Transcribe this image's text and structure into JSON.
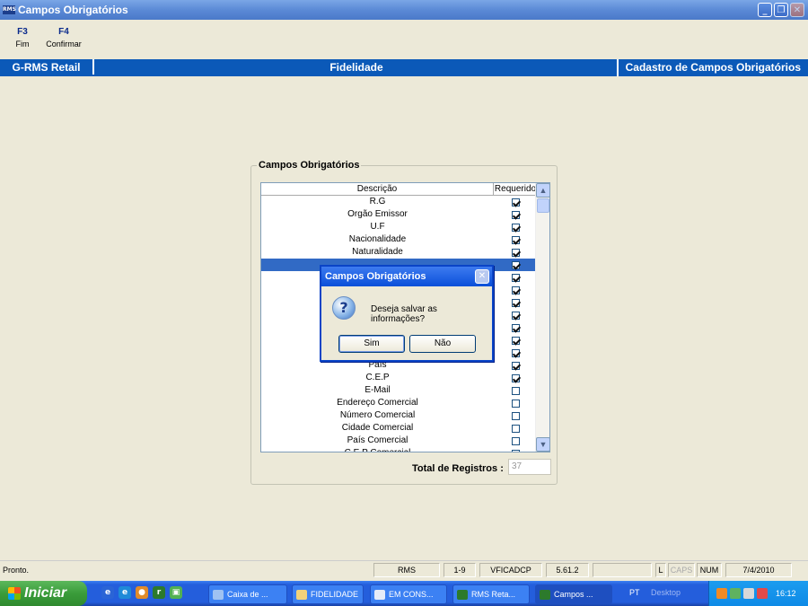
{
  "window": {
    "title": "Campos Obrigatórios",
    "app_icon_text": "RMS"
  },
  "toolbar": {
    "keys": [
      {
        "key": "F3",
        "label": "Fim"
      },
      {
        "key": "F4",
        "label": "Confirmar"
      }
    ]
  },
  "header": {
    "left": "G-RMS Retail",
    "center": "Fidelidade",
    "right": "Cadastro de Campos Obrigatórios"
  },
  "group": {
    "title": "Campos Obrigatórios",
    "columns": {
      "description": "Descrição",
      "required": "Requerido"
    },
    "rows": [
      {
        "desc": "R.G",
        "checked": true
      },
      {
        "desc": "Orgão Emissor",
        "checked": true
      },
      {
        "desc": "U.F",
        "checked": true
      },
      {
        "desc": "Nacionalidade",
        "checked": true
      },
      {
        "desc": "Naturalidade",
        "checked": true
      },
      {
        "desc": "",
        "checked": true,
        "selected": true
      },
      {
        "desc": "",
        "checked": true
      },
      {
        "desc": "",
        "checked": true
      },
      {
        "desc": "",
        "checked": true
      },
      {
        "desc": "",
        "checked": true
      },
      {
        "desc": "",
        "checked": true
      },
      {
        "desc": "",
        "checked": true
      },
      {
        "desc": "",
        "checked": true
      },
      {
        "desc": "País",
        "checked": true
      },
      {
        "desc": "C.E.P",
        "checked": true
      },
      {
        "desc": "E-Mail",
        "checked": false
      },
      {
        "desc": "Endereço Comercial",
        "checked": false
      },
      {
        "desc": "Número Comercial",
        "checked": false
      },
      {
        "desc": "Cidade Comercial",
        "checked": false
      },
      {
        "desc": "País Comercial",
        "checked": false
      },
      {
        "desc": "C.E.P Comercial",
        "checked": false
      }
    ],
    "total_label": "Total de Registros :",
    "total_value": "37"
  },
  "dialog": {
    "title": "Campos Obrigatórios",
    "message": "Deseja salvar as informações?",
    "yes": "Sim",
    "no": "Não"
  },
  "statusbar": {
    "text": "Pronto.",
    "panels": [
      "RMS",
      "1-9",
      "VFICADCP",
      "5.61.2",
      "",
      "L",
      "CAPS",
      "NUM",
      "7/4/2010"
    ]
  },
  "taskbar": {
    "start": "Iniciar",
    "buttons": [
      "Caixa de ...",
      "FIDELIDADE",
      "EM CONS...",
      "RMS Reta...",
      "Campos ..."
    ],
    "lang": "PT",
    "desktop": "Desktop",
    "clock": "16:12"
  }
}
